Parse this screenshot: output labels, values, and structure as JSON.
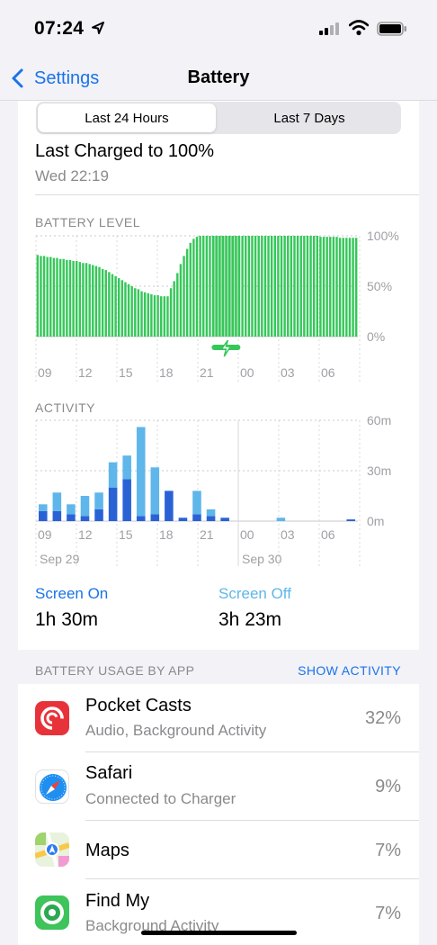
{
  "status_bar": {
    "time": "07:24"
  },
  "nav": {
    "back_label": "Settings",
    "title": "Battery"
  },
  "segments": {
    "active": "Last 24 Hours",
    "inactive": "Last 7 Days"
  },
  "last_charged": {
    "title": "Last Charged to 100%",
    "time": "Wed 22:19"
  },
  "battery_section": {
    "label": "BATTERY LEVEL"
  },
  "activity_section": {
    "label": "ACTIVITY"
  },
  "screen": {
    "on_label": "Screen On",
    "on_value": "1h 30m",
    "off_label": "Screen Off",
    "off_value": "3h 23m"
  },
  "usage": {
    "header": "BATTERY USAGE BY APP",
    "show_activity": "SHOW ACTIVITY"
  },
  "apps": [
    {
      "name": "Pocket Casts",
      "subtitle": "Audio, Background Activity",
      "percent": "32%",
      "icon": "pocket-casts-icon"
    },
    {
      "name": "Safari",
      "subtitle": "Connected to Charger",
      "percent": "9%",
      "icon": "safari-icon"
    },
    {
      "name": "Maps",
      "subtitle": "",
      "percent": "7%",
      "icon": "maps-icon"
    },
    {
      "name": "Find My",
      "subtitle": "Background Activity",
      "percent": "7%",
      "icon": "find-my-icon"
    }
  ],
  "colors": {
    "accent": "#1a73e8",
    "battery_green": "#35c759",
    "charging_band": "#b8e6c2",
    "screen_on": "#2a62d6",
    "screen_off": "#5fb6ea"
  },
  "chart_data": [
    {
      "type": "bar",
      "title": "BATTERY LEVEL",
      "x_ticks": [
        "09",
        "12",
        "15",
        "18",
        "21",
        "00",
        "03",
        "06"
      ],
      "y_ticks": [
        "100%",
        "50%",
        "0%"
      ],
      "ylim": [
        0,
        100
      ],
      "charging_period": {
        "start": 20.4,
        "end": 22.3
      },
      "series": [
        {
          "values": [
            81,
            80,
            80,
            79,
            79,
            78,
            78,
            77,
            77,
            76,
            76,
            75,
            75,
            74,
            73,
            73,
            72,
            71,
            70,
            69,
            67,
            66,
            64,
            62,
            60,
            58,
            56,
            54,
            52,
            50,
            48,
            47,
            45,
            44,
            43,
            42,
            41,
            41,
            40,
            40,
            40,
            48,
            55,
            63,
            72,
            80,
            87,
            93,
            97,
            99,
            100,
            100,
            100,
            100,
            100,
            100,
            100,
            100,
            100,
            100,
            100,
            100,
            100,
            100,
            100,
            100,
            100,
            100,
            100,
            100,
            100,
            100,
            100,
            100,
            100,
            100,
            100,
            100,
            100,
            100,
            100,
            100,
            100,
            100,
            100,
            100,
            100,
            99,
            99,
            99,
            99,
            99,
            99,
            98,
            98,
            98,
            98,
            98,
            98
          ]
        }
      ],
      "x_hours": {
        "first": 8.7,
        "last": 6.5
      }
    },
    {
      "type": "bar",
      "title": "ACTIVITY",
      "x_ticks": [
        "09",
        "12",
        "15",
        "18",
        "21",
        "00",
        "03",
        "06"
      ],
      "date_labels": [
        "Sep 29",
        "Sep 30"
      ],
      "y_ticks": [
        "60m",
        "30m",
        "0m"
      ],
      "ylim": [
        0,
        60
      ],
      "categories": [
        "08",
        "09",
        "10",
        "11",
        "12",
        "13",
        "14",
        "15",
        "16",
        "17",
        "18",
        "19",
        "20",
        "21",
        "22",
        "23",
        "00",
        "01",
        "02",
        "03",
        "04",
        "05",
        "06"
      ],
      "series": [
        {
          "name": "Screen On",
          "values": [
            6,
            6,
            4,
            3,
            7,
            20,
            25,
            3,
            4,
            18,
            2,
            4,
            3,
            2,
            0,
            0,
            0,
            0,
            0,
            0,
            0,
            0,
            1
          ]
        },
        {
          "name": "Screen Off",
          "values": [
            4,
            11,
            6,
            12,
            10,
            15,
            14,
            53,
            28,
            0,
            0,
            14,
            4,
            0,
            0,
            0,
            0,
            2,
            0,
            0,
            0,
            0,
            0
          ]
        }
      ]
    }
  ]
}
